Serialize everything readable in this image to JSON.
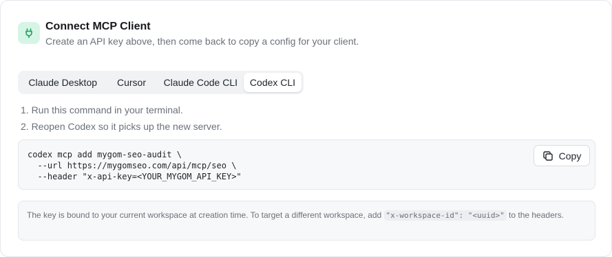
{
  "header": {
    "title": "Connect MCP Client",
    "subtitle": "Create an API key above, then come back to copy a config for your client.",
    "icon": "plug-icon",
    "accent_bg": "#d7f5e6",
    "accent_fg": "#1f9d63"
  },
  "tabs": [
    {
      "label": "Claude Desktop",
      "active": false
    },
    {
      "label": "Cursor",
      "active": false
    },
    {
      "label": "Claude Code CLI",
      "active": false
    },
    {
      "label": "Codex CLI",
      "active": true
    }
  ],
  "steps": [
    "1. Run this command in your terminal.",
    "2. Reopen Codex so it picks up the new server."
  ],
  "code": {
    "lines": [
      "codex mcp add mygom-seo-audit \\",
      "  --url https://mygomseo.com/api/mcp/seo \\",
      "  --header \"x-api-key=<YOUR_MYGOM_API_KEY>\""
    ],
    "copy_label": "Copy",
    "copy_icon": "copy-icon"
  },
  "note": {
    "text_before": "The key is bound to your current workspace at creation time. To target a different workspace, add ",
    "code_key": "\"x-workspace-id\": \"<uuid>\"",
    "text_after": " to the headers."
  }
}
